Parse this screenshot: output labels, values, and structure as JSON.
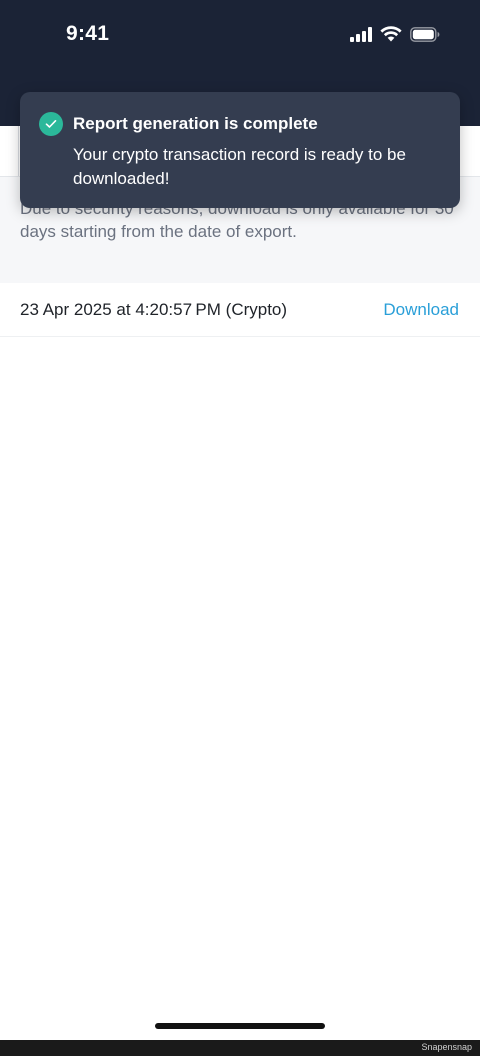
{
  "status_bar": {
    "time": "9:41",
    "icons": [
      "cellular-signal-icon",
      "wifi-icon",
      "battery-icon"
    ]
  },
  "toast": {
    "icon": "check-circle-icon",
    "icon_color": "#2bb89a",
    "title": "Report generation is complete",
    "message": "Your crypto transaction record is ready to be downloaded!"
  },
  "notice": {
    "text": "Due to security reasons, download is only available for 30 days starting from the date of export."
  },
  "exports": [
    {
      "label": "23 Apr 2025 at 4:20:57 PM (Crypto)",
      "action_label": "Download"
    }
  ],
  "watermark": "Snapensnap",
  "colors": {
    "header_bg": "#1b2336",
    "toast_bg": "#343d50",
    "link": "#2a9fd8",
    "notice_bg": "#f6f7f9"
  }
}
